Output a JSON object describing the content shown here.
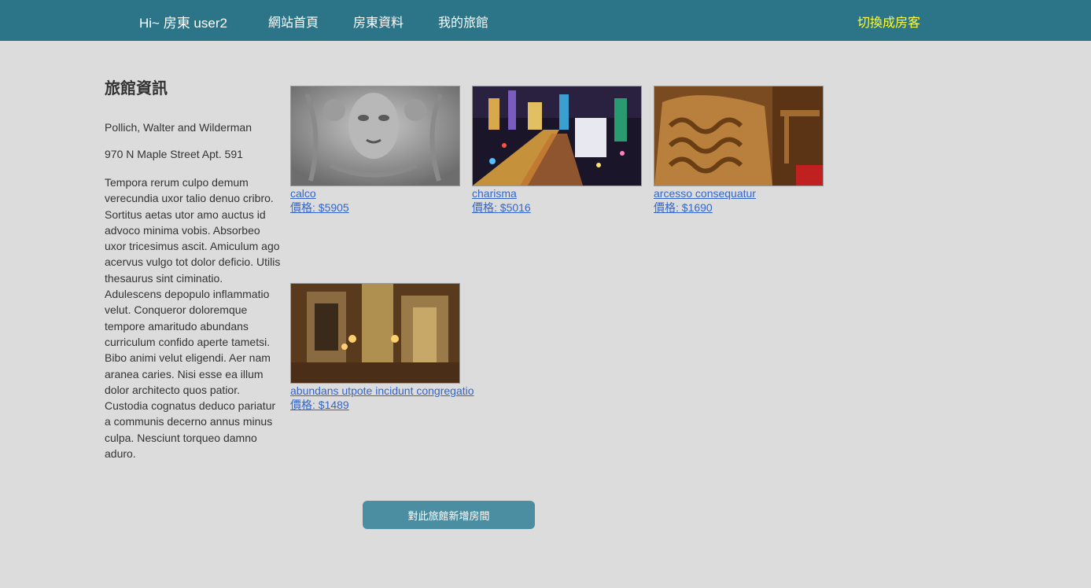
{
  "nav": {
    "greeting": "Hi~ 房東 user2",
    "links": [
      "網站首頁",
      "房東資料",
      "我的旅館"
    ],
    "switch_label": "切換成房客"
  },
  "hotel": {
    "heading": "旅館資訊",
    "name": "Pollich, Walter and Wilderman",
    "address": "970 N Maple Street Apt. 591",
    "description": "Tempora rerum culpo demum verecundia uxor talio denuo cribro. Sortitus aetas utor amo auctus id advoco minima vobis. Absorbeo uxor tricesimus ascit. Amiculum ago acervus vulgo tot dolor deficio. Utilis thesaurus sint ciminatio. Adulescens depopulo inflammatio velut. Conqueror doloremque tempore amaritudo abundans curriculum confido aperte tametsi. Bibo animi velut eligendi. Aer nam aranea caries. Nisi esse ea illum dolor architecto quos patior. Custodia cognatus deduco pariatur a communis decerno annus minus culpa. Nesciunt torqueo damno aduro."
  },
  "rooms": [
    {
      "name": "calco",
      "price": "價格: $5905",
      "image": "stone-sculpture-face"
    },
    {
      "name": "charisma",
      "price": "價格: $5016",
      "image": "city-night-lights"
    },
    {
      "name": "arcesso consequatur",
      "price": "價格: $1690",
      "image": "carved-wooden-chair"
    },
    {
      "name": "abundans utpote incidunt congregatio",
      "price": "價格: $1489",
      "image": "ornate-gold-interior"
    }
  ],
  "actions": {
    "add_room": "對此旅館新增房間"
  },
  "colors": {
    "navbar": "#2c7488",
    "switch": "#ffff33",
    "link": "#3366cc",
    "button": "#4b8ea1",
    "background": "#dcdcdc"
  }
}
